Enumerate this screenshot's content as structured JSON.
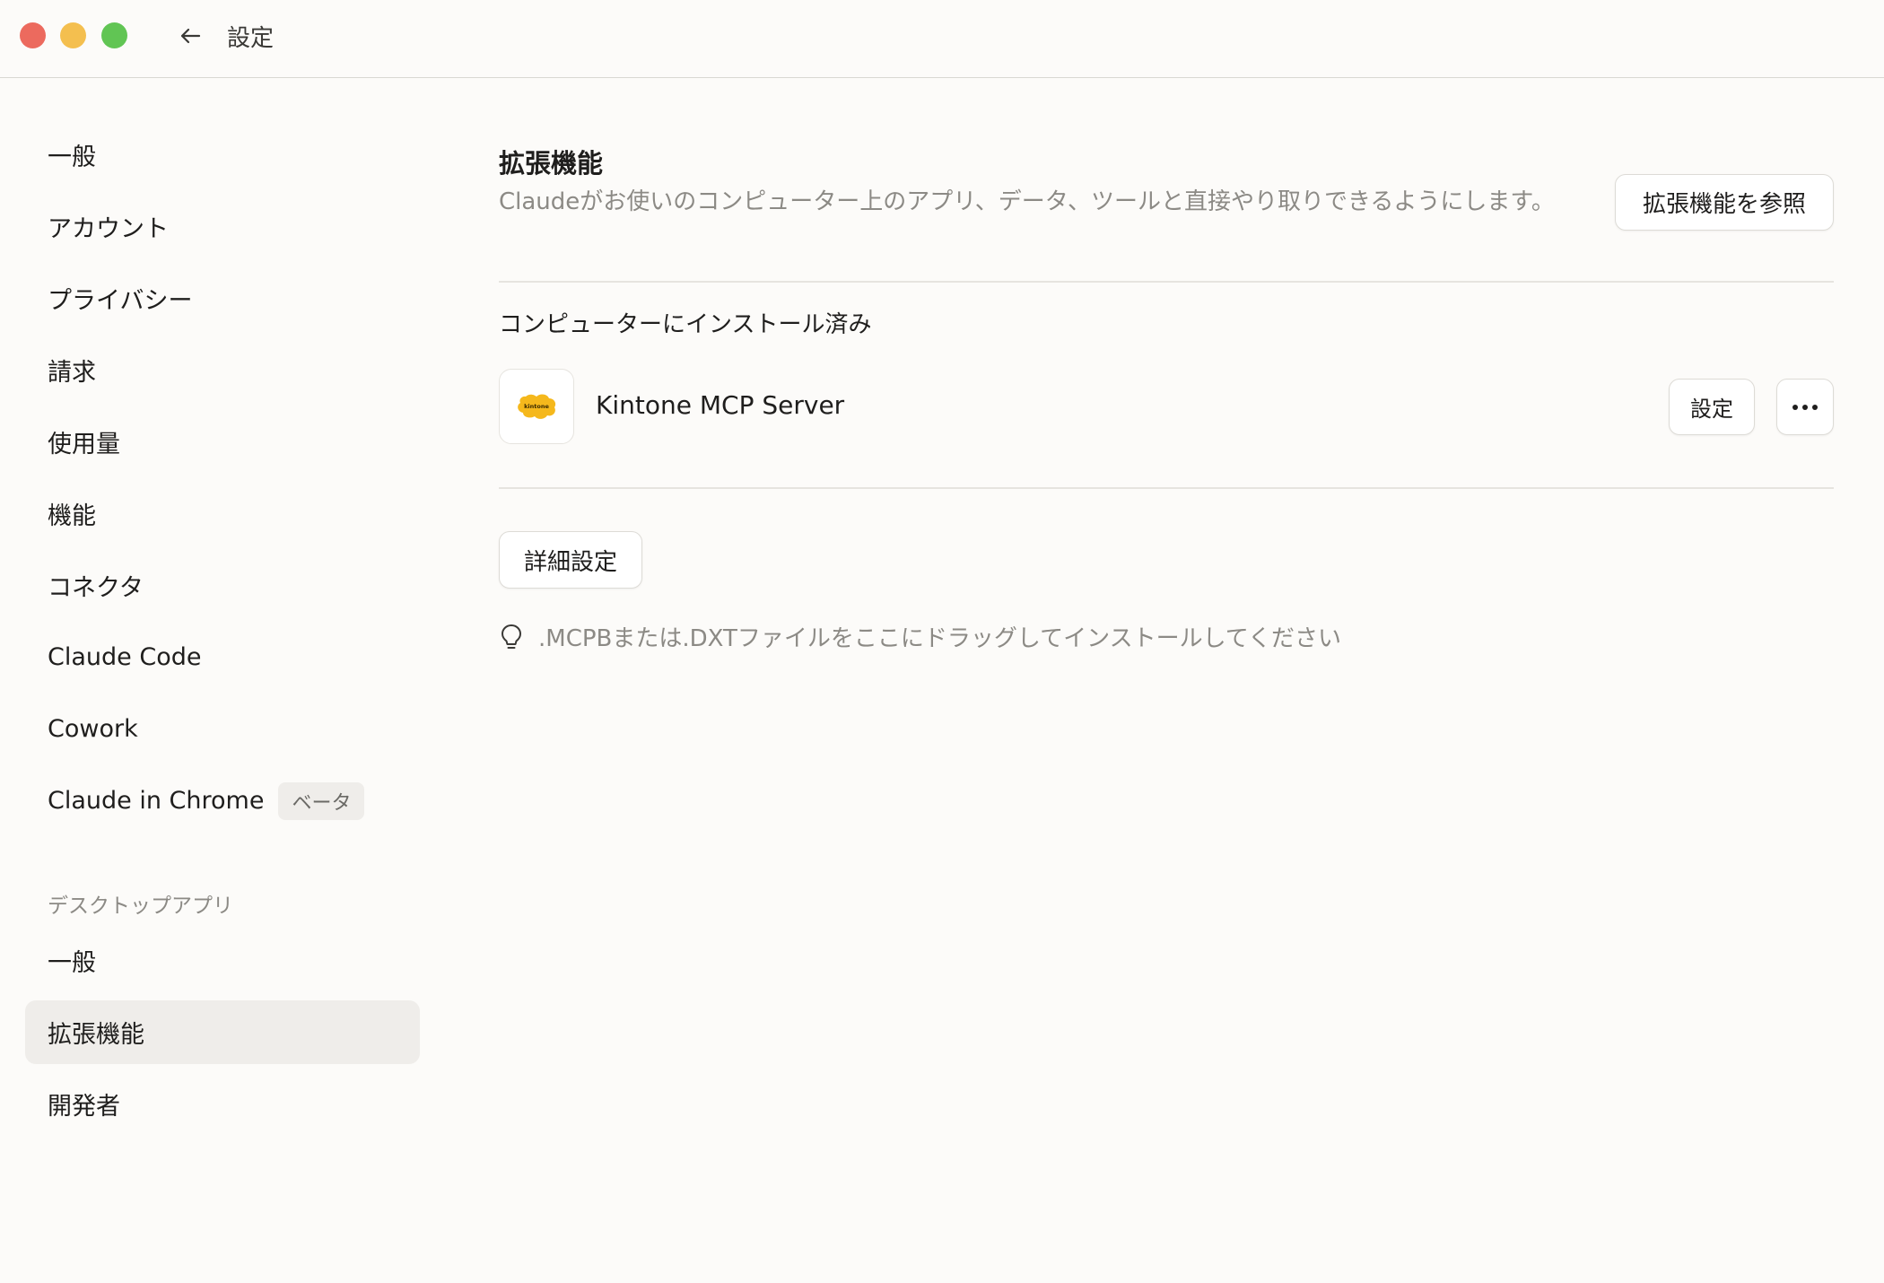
{
  "window": {
    "title": "設定"
  },
  "sidebar": {
    "items": [
      {
        "label": "一般"
      },
      {
        "label": "アカウント"
      },
      {
        "label": "プライバシー"
      },
      {
        "label": "請求"
      },
      {
        "label": "使用量"
      },
      {
        "label": "機能"
      },
      {
        "label": "コネクタ"
      },
      {
        "label": "Claude Code"
      },
      {
        "label": "Cowork"
      },
      {
        "label": "Claude in Chrome",
        "badge": "ベータ"
      }
    ],
    "desktop_section_label": "デスクトップアプリ",
    "desktop_items": [
      {
        "label": "一般"
      },
      {
        "label": "拡張機能",
        "active": true
      },
      {
        "label": "開発者"
      }
    ]
  },
  "main": {
    "title": "拡張機能",
    "description": "Claudeがお使いのコンピューター上のアプリ、データ、ツールと直接やり取りできるようにします。",
    "browse_button": "拡張機能を参照",
    "installed_heading": "コンピューターにインストール済み",
    "extensions": [
      {
        "name": "Kintone MCP Server",
        "icon": "kintone-logo",
        "icon_text": "kintone",
        "icon_color": "#f5b81c",
        "settings_label": "設定"
      }
    ],
    "advanced_button": "詳細設定",
    "drop_hint": ".MCPBまたは.DXTファイルをここにドラッグしてインストールしてください"
  }
}
